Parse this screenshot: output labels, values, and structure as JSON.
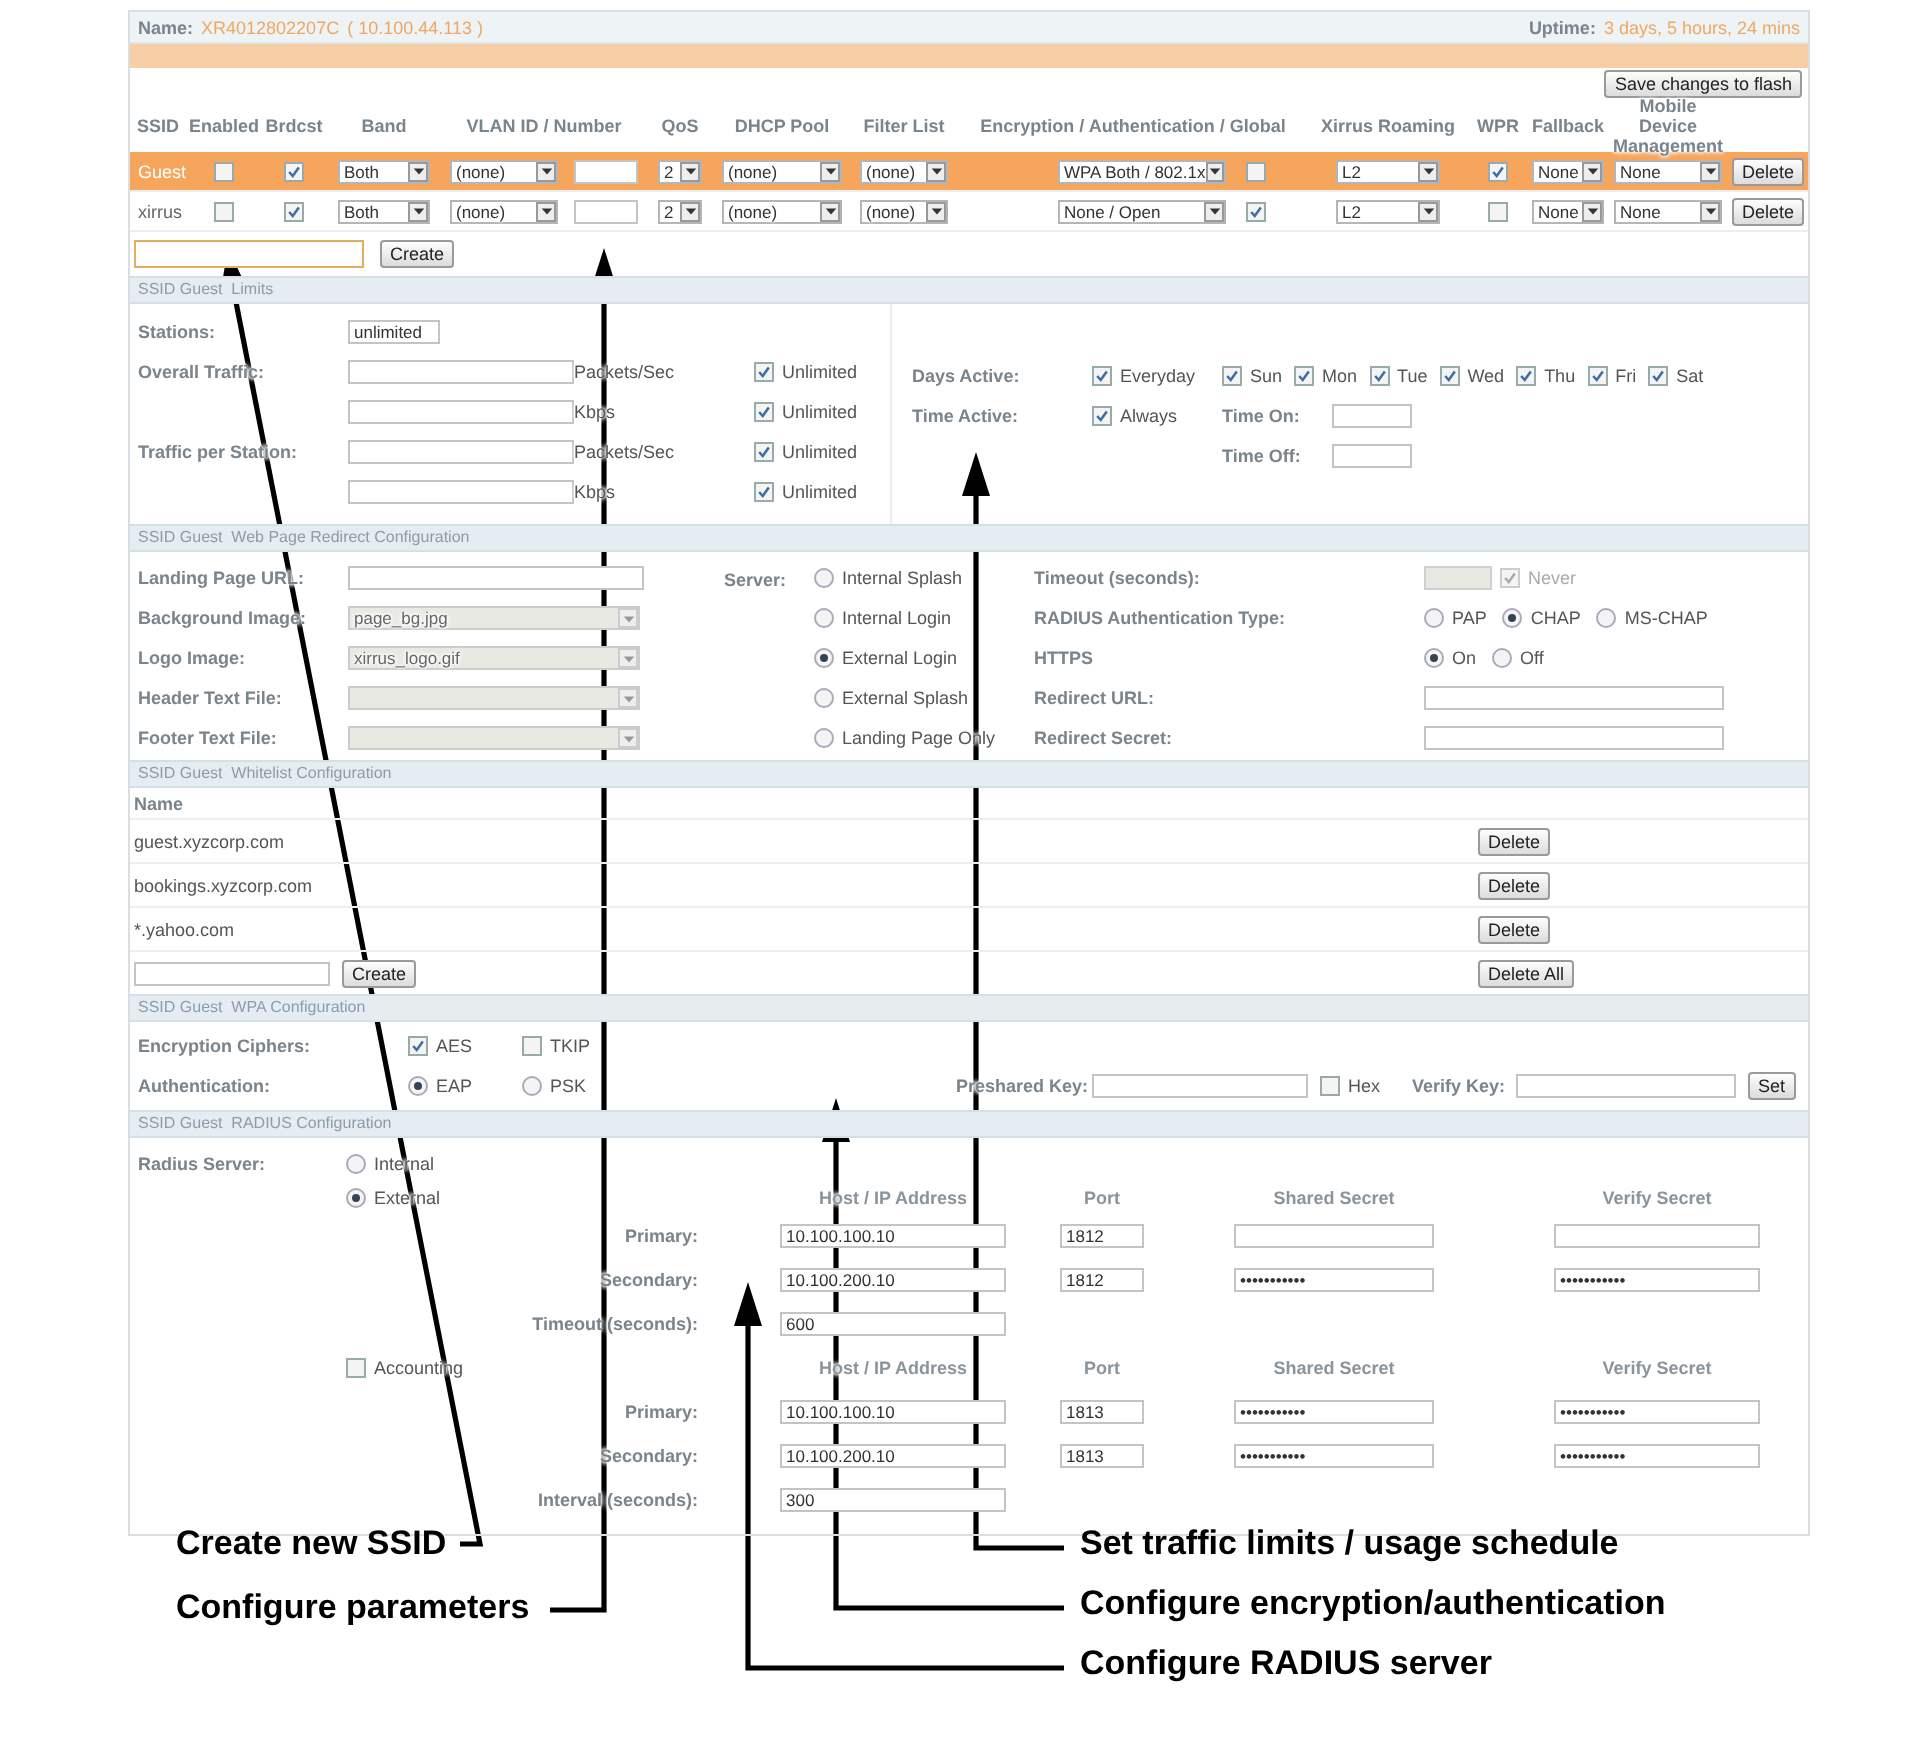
{
  "header": {
    "name_label": "Name:",
    "name_value": "XR4012802207C",
    "address": "( 10.100.44.113 )",
    "uptime_label": "Uptime:",
    "uptime_value": "3 days, 5 hours, 24 mins"
  },
  "save_button": "Save changes to flash",
  "ssid_table": {
    "columns": [
      "SSID",
      "Enabled",
      "Brdcst",
      "Band",
      "VLAN ID / Number",
      "QoS",
      "DHCP Pool",
      "Filter List",
      "Encryption / Authentication / Global",
      "Xirrus Roaming",
      "WPR",
      "Fallback",
      "Mobile Device Management"
    ],
    "rows": [
      {
        "selected": true,
        "ssid": "Guest",
        "enabled": false,
        "broadcast": true,
        "band": "Both",
        "vlan": "(none)",
        "qos": "2",
        "dhcp_pool": "(none)",
        "filter_list": "(none)",
        "encryption": "WPA Both / 802.1x",
        "global": false,
        "roaming": "L2",
        "wpr": true,
        "fallback": "None",
        "mdm": "None",
        "delete": "Delete"
      },
      {
        "selected": false,
        "ssid": "xirrus",
        "enabled": false,
        "broadcast": true,
        "band": "Both",
        "vlan": "(none)",
        "qos": "2",
        "dhcp_pool": "(none)",
        "filter_list": "(none)",
        "encryption": "None / Open",
        "global": true,
        "roaming": "L2",
        "wpr": false,
        "fallback": "None",
        "mdm": "None",
        "delete": "Delete"
      }
    ]
  },
  "create_button": "Create",
  "limits": {
    "title": "SSID Guest  Limits",
    "stations_label": "Stations:",
    "stations_value": "unlimited",
    "traffic": [
      {
        "label": "Overall Traffic:",
        "unit": "Packets/Sec",
        "unlimited": "Unlimited",
        "checked": true
      },
      {
        "unit": "Kbps",
        "unlimited": "Unlimited",
        "checked": true
      },
      {
        "label": "Traffic per Station:",
        "unit": "Packets/Sec",
        "unlimited": "Unlimited",
        "checked": true
      },
      {
        "unit": "Kbps",
        "unlimited": "Unlimited",
        "checked": true
      }
    ],
    "days_label": "Days Active:",
    "everyday": {
      "label": "Everyday",
      "checked": true
    },
    "days": [
      {
        "label": "Sun",
        "checked": true
      },
      {
        "label": "Mon",
        "checked": true
      },
      {
        "label": "Tue",
        "checked": true
      },
      {
        "label": "Wed",
        "checked": true
      },
      {
        "label": "Thu",
        "checked": true
      },
      {
        "label": "Fri",
        "checked": true
      },
      {
        "label": "Sat",
        "checked": true
      }
    ],
    "time_label": "Time Active:",
    "always": {
      "label": "Always",
      "checked": true
    },
    "time_on_label": "Time On:",
    "time_off_label": "Time Off:"
  },
  "redirect": {
    "title": "SSID Guest  Web Page Redirect Configuration",
    "fields": [
      {
        "label": "Landing Page URL:",
        "kind": "input",
        "disabled": false
      },
      {
        "label": "Background Image:",
        "kind": "select",
        "value": "page_bg.jpg",
        "disabled": true
      },
      {
        "label": "Logo Image:",
        "kind": "select",
        "value": "xirrus_logo.gif",
        "disabled": true
      },
      {
        "label": "Header Text File:",
        "kind": "select",
        "disabled": true
      },
      {
        "label": "Footer Text File:",
        "kind": "select",
        "disabled": true
      }
    ],
    "server_label": "Server:",
    "servers": [
      {
        "label": "Internal Splash",
        "selected": false
      },
      {
        "label": "Internal Login",
        "selected": false
      },
      {
        "label": "External Login",
        "selected": true
      },
      {
        "label": "External Splash",
        "selected": false
      },
      {
        "label": "Landing Page Only",
        "selected": false
      }
    ],
    "timeout_label": "Timeout (seconds):",
    "never": {
      "label": "Never",
      "checked": true
    },
    "auth_type_label": "RADIUS Authentication Type:",
    "auth_types": [
      {
        "label": "PAP",
        "selected": false
      },
      {
        "label": "CHAP",
        "selected": true
      },
      {
        "label": "MS-CHAP",
        "selected": false
      }
    ],
    "https_label": "HTTPS",
    "https": [
      {
        "label": "On",
        "selected": true
      },
      {
        "label": "Off",
        "selected": false
      }
    ],
    "redirect_url_label": "Redirect URL:",
    "redirect_secret_label": "Redirect Secret:"
  },
  "whitelist": {
    "title": "SSID Guest  Whitelist Configuration",
    "column": "Name",
    "entries": [
      {
        "name": "guest.xyzcorp.com",
        "delete": "Delete"
      },
      {
        "name": "bookings.xyzcorp.com",
        "delete": "Delete"
      },
      {
        "name": "*.yahoo.com",
        "delete": "Delete"
      }
    ],
    "create": "Create",
    "delete_all": "Delete All"
  },
  "wpa": {
    "title": "SSID Guest  WPA Configuration",
    "ciphers_label": "Encryption Ciphers:",
    "ciphers": [
      {
        "label": "AES",
        "checked": true
      },
      {
        "label": "TKIP",
        "checked": false
      }
    ],
    "auth_label": "Authentication:",
    "auth": [
      {
        "label": "EAP",
        "selected": true
      },
      {
        "label": "PSK",
        "selected": false
      }
    ],
    "psk_label": "Preshared Key:",
    "hex": {
      "label": "Hex",
      "checked": false
    },
    "verify_label": "Verify Key:",
    "set": "Set"
  },
  "radius": {
    "title": "SSID Guest  RADIUS Configuration",
    "server_label": "Radius Server:",
    "servers": [
      {
        "label": "Internal",
        "selected": false
      },
      {
        "label": "External",
        "selected": true
      }
    ],
    "columns": [
      "Host / IP Address",
      "Port",
      "Shared Secret",
      "Verify Secret"
    ],
    "auth_rows": [
      {
        "label": "Primary:",
        "host": "10.100.100.10",
        "port": "1812"
      },
      {
        "label": "Secondary:",
        "host": "10.100.200.10",
        "port": "1812",
        "secret": "•••••••••••",
        "verify": "•••••••••••"
      }
    ],
    "timeout_label": "Timeout (seconds):",
    "timeout": "600",
    "accounting": {
      "label": "Accounting",
      "checked": false
    },
    "accounting_columns": [
      "Host / IP Address",
      "Port",
      "Shared Secret",
      "Verify Secret"
    ],
    "accounting_rows": [
      {
        "label": "Primary:",
        "host": "10.100.100.10",
        "port": "1813",
        "secret": "•••••••••••",
        "verify": "•••••••••••"
      },
      {
        "label": "Secondary:",
        "host": "10.100.200.10",
        "port": "1813",
        "secret": "•••••••••••",
        "verify": "•••••••••••"
      }
    ],
    "interval_label": "Interval (seconds):",
    "interval": "300"
  },
  "callouts": [
    "Create new SSID",
    "Configure parameters",
    "Set traffic limits / usage schedule",
    "Configure encryption/authentication",
    "Configure RADIUS server"
  ]
}
